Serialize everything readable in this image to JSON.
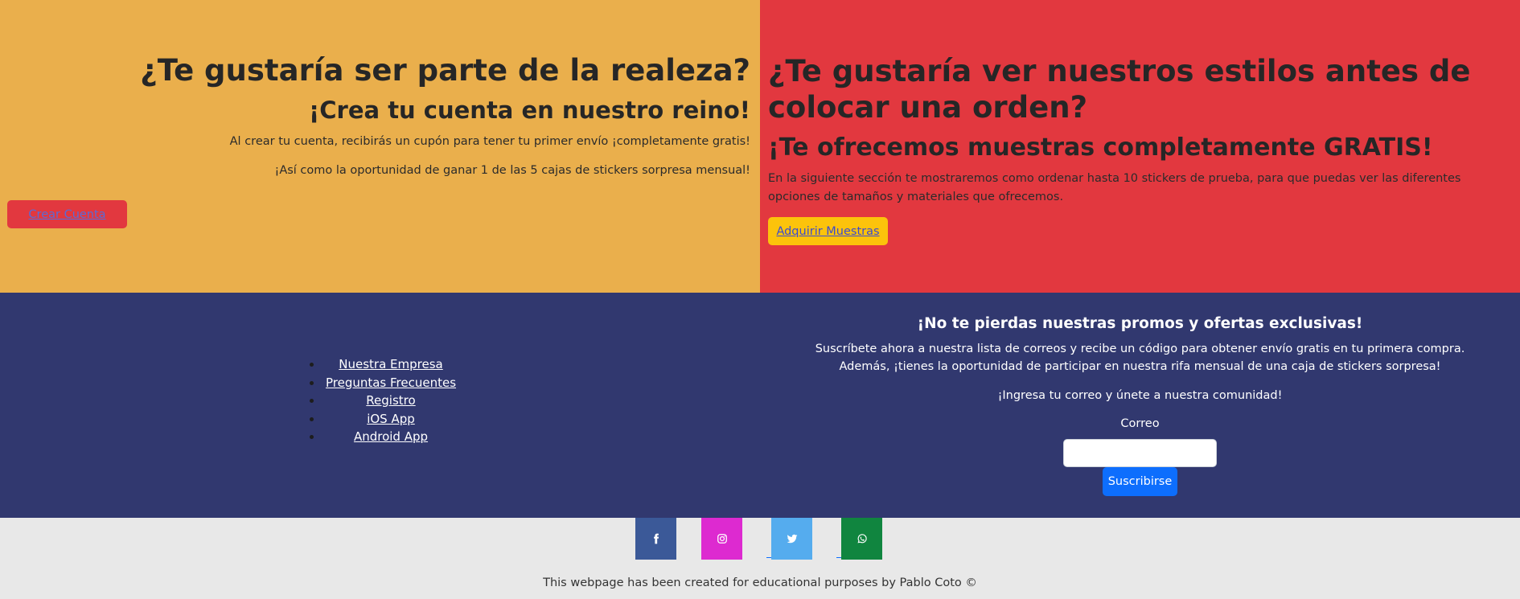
{
  "hero_left": {
    "title": "¿Te gustaría ser parte de la realeza?",
    "subtitle": "¡Crea tu cuenta en nuestro reino!",
    "line1": "Al crear tu cuenta, recibirás un cupón para tener tu primer envío ¡completamente gratis!",
    "line2": "¡Así como la oportunidad de ganar 1 de las 5 cajas de stickers sorpresa mensual!",
    "button_label": "Crear Cuenta"
  },
  "hero_right": {
    "title": "¿Te gustaría ver nuestros estilos antes de colocar una orden?",
    "subtitle": "¡Te ofrecemos muestras completamente GRATIS!",
    "description": "En la siguiente sección te mostraremos como ordenar hasta 10 stickers de prueba, para que puedas ver las diferentes opciones de tamaños y materiales que ofrecemos.",
    "button_label": "Adquirir Muestras"
  },
  "footer_links": [
    "Nuestra Empresa",
    "Preguntas Frecuentes",
    "Registro",
    "iOS App",
    "Android App"
  ],
  "newsletter": {
    "title": "¡No te pierdas nuestras promos y ofertas exclusivas!",
    "description": "Suscríbete ahora a nuestra lista de correos y recibe un código para obtener envío gratis en tu primera compra. Además, ¡tienes la oportunidad de participar en nuestra rifa mensual de una caja de stickers sorpresa!",
    "cta": "¡Ingresa tu correo y únete a nuestra comunidad!",
    "email_label": "Correo",
    "email_value": "",
    "button_label": "Suscribirse"
  },
  "social": [
    {
      "icon": "facebook-icon",
      "color": "#3b5998"
    },
    {
      "icon": "instagram-icon",
      "color": "#dd2ad0"
    },
    {
      "icon": "twitter-icon",
      "color": "#55acee"
    },
    {
      "icon": "whatsapp-icon",
      "color": "#10853f"
    }
  ],
  "credit": "This webpage has been created for educational purposes by Pablo Coto ©",
  "colors": {
    "left_bg": "#eaaf4c",
    "right_bg": "#e2383f",
    "footer_bg": "#31386f",
    "bottom_bg": "#e8e8e8",
    "subscribe_button": "#0d6efd",
    "samples_button": "#fcc30b"
  }
}
